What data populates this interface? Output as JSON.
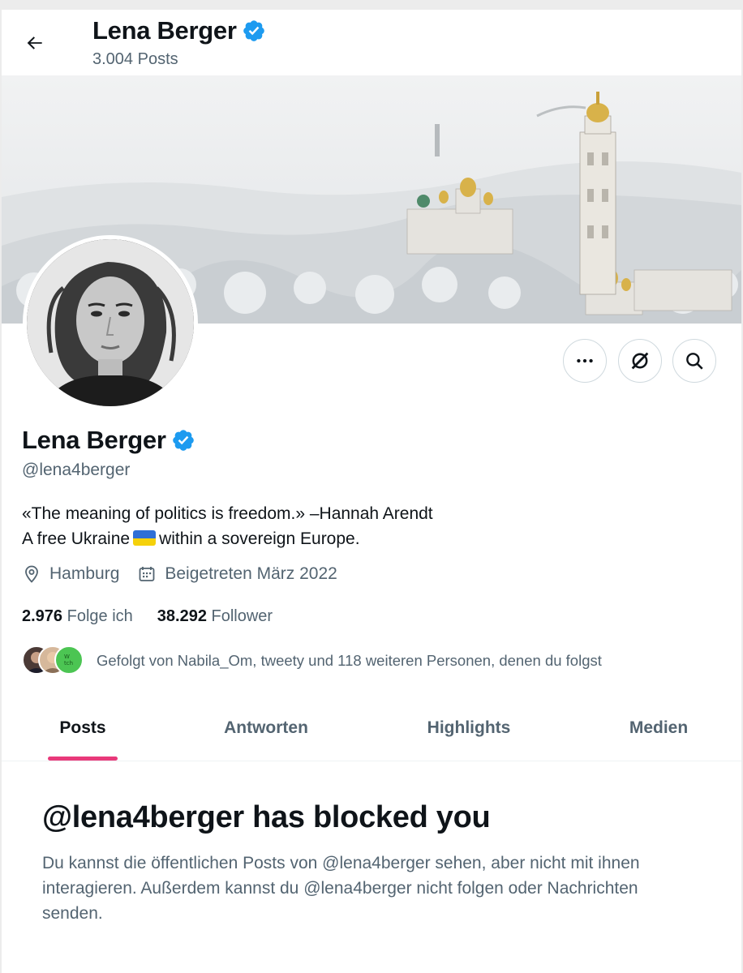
{
  "header": {
    "name": "Lena Berger",
    "posts_count": "3.004 Posts"
  },
  "profile": {
    "name": "Lena Berger",
    "handle": "@lena4berger",
    "bio_line1": "«The meaning of politics is freedom.» –Hannah Arendt",
    "bio_line2_before": "A free Ukraine",
    "bio_line2_after": "within a sovereign Europe.",
    "location": "Hamburg",
    "joined": "Beigetreten März 2022",
    "following_count": "2.976",
    "following_label": "Folge ich",
    "followers_count": "38.292",
    "followers_label": "Follower",
    "followed_by": "Gefolgt von Nabila_Om, tweety und 118 weiteren Personen, denen du folgst"
  },
  "icons": {
    "back": "arrow-left-icon",
    "verified": "verified-badge-icon",
    "more": "more-horizontal-icon",
    "grok": "grok-icon",
    "search": "search-icon",
    "location": "location-pin-icon",
    "calendar": "calendar-icon"
  },
  "tabs": [
    {
      "label": "Posts",
      "active": true
    },
    {
      "label": "Antworten",
      "active": false
    },
    {
      "label": "Highlights",
      "active": false
    },
    {
      "label": "Medien",
      "active": false
    }
  ],
  "blocked": {
    "title": "@lena4berger has blocked you",
    "description": "Du kannst die öffentlichen Posts von @lena4berger sehen, aber nicht mit ihnen interagieren. Außerdem kannst du @lena4berger nicht folgen oder Nachrichten senden."
  },
  "colors": {
    "verified_blue": "#1d9bf0",
    "tab_indicator": "#e8397a",
    "secondary_text": "#536471"
  }
}
